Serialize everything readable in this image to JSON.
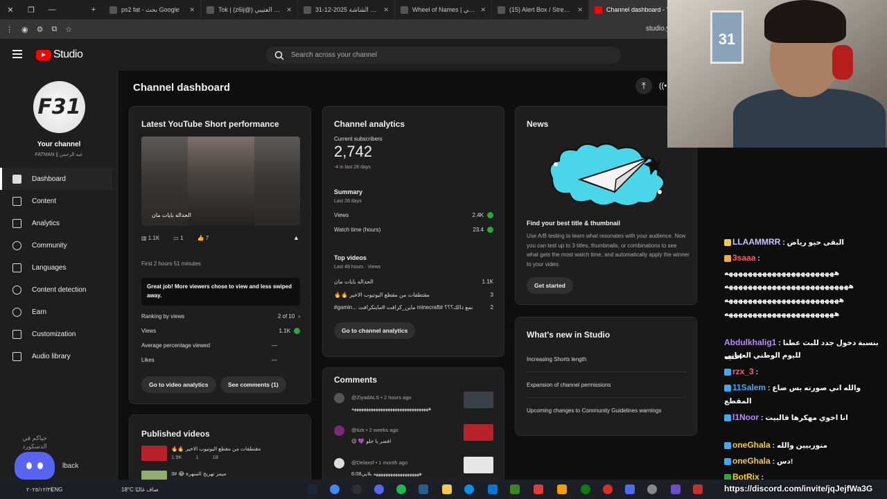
{
  "browser": {
    "tabs": [
      {
        "title": "ps2 fat - بحث Google",
        "active": false
      },
      {
        "title": "Tok | (z6ij@) تركي العتيبي",
        "active": false
      },
      {
        "title": "31-12-2025 لقطة الشاشة",
        "active": false
      },
      {
        "title": "Wheel of Names | عشوائي",
        "active": false
      },
      {
        "title": "(15) Alert Box / Streamlab",
        "active": false
      },
      {
        "title": "Channel dashboard - You",
        "active": true
      }
    ],
    "url": "studio.y"
  },
  "header": {
    "logo_text": "Studio",
    "search_placeholder": "Search across your channel"
  },
  "sidebar": {
    "avatar_text": "F31",
    "your_channel": "Your channel",
    "channel_name": "FATMAN || عبد الرحمن",
    "items": [
      {
        "label": "Dashboard",
        "icon": "dashboard-icon",
        "active": true
      },
      {
        "label": "Content",
        "icon": "content-icon"
      },
      {
        "label": "Analytics",
        "icon": "analytics-icon"
      },
      {
        "label": "Community",
        "icon": "community-icon"
      },
      {
        "label": "Languages",
        "icon": "languages-icon"
      },
      {
        "label": "Content detection",
        "icon": "copyright-icon"
      },
      {
        "label": "Earn",
        "icon": "earn-icon"
      },
      {
        "label": "Customization",
        "icon": "customization-icon"
      },
      {
        "label": "Audio library",
        "icon": "audio-library-icon"
      }
    ],
    "feedback": "lback",
    "discord_overlay": "حياكم في الدسكورد"
  },
  "main": {
    "title": "Channel dashboard",
    "short": {
      "heading": "Latest YouTube Short performance",
      "thumb_caption": "الحداله بايات مان",
      "views": "1.1K",
      "comments": "1",
      "likes": "7",
      "first_time": "First 2 hours 51 minutes",
      "callout": "Great job! More viewers chose to view and less swiped away.",
      "ranking_label": "Ranking by views",
      "ranking_value": "2 of 10",
      "views_label": "Views",
      "views_value": "1.1K",
      "avg_label": "Average percentage viewed",
      "avg_value": "—",
      "likes_label": "Likes",
      "likes_value": "—",
      "btn_analytics": "Go to video analytics",
      "btn_comments": "See comments (1)"
    },
    "analytics": {
      "heading": "Channel analytics",
      "subs_label": "Current subscribers",
      "subs_value": "2,742",
      "subs_delta": "-4",
      "subs_delta_suffix": "in last 28 days",
      "summary": "Summary",
      "summary_sub": "Last 28 days",
      "views_label": "Views",
      "views_value": "2.4K",
      "watch_label": "Watch time (hours)",
      "watch_value": "23.4",
      "top_videos": "Top videos",
      "top_sub": "Last 48 hours · Views",
      "videos": [
        {
          "title": "الحداله بايات مان",
          "views": "1.1K"
        },
        {
          "title": "🔥🔥 مقتطفات من مقطع اليوتيوب الاخير",
          "views": "3"
        },
        {
          "title": "#gamin... ماين_كرافت #ماينكرافت minecraft# ورش المجمع دالك؟؟؟",
          "views": "2"
        }
      ],
      "btn": "Go to channel analytics"
    },
    "comments": {
      "heading": "Comments",
      "items": [
        {
          "author": "@ZiyadALS",
          "time": "• 2 hours ago",
          "text": "ههههههههههههههههههههههههههههههههه"
        },
        {
          "author": "@tizk",
          "time": "• 2 weeks ago",
          "text": "😉 💜 افضر يا حلو"
        },
        {
          "author": "@Delaxsf",
          "time": "• 1 month ago",
          "text": "6:08هههههههههههههههههههه بلايي"
        }
      ]
    },
    "news": {
      "heading": "News",
      "title": "Find your best title & thumbnail",
      "desc": "Use A/B testing to learn what resonates with your audience. Now you can test up to 3 titles, thumbnails, or combinations to see what gets the most watch time, and automatically apply the winner to your video.",
      "btn": "Get started"
    },
    "whats_new": {
      "heading": "What's new in Studio",
      "items": [
        "Increasing Shorts length",
        "Expansion of channel permissions",
        "Upcoming changes to Community Guidelines warnings"
      ]
    },
    "published": {
      "heading": "Published videos",
      "items": [
        {
          "title": "🔥🔥 مقتطفات من مقطع اليوتيوب الاخير",
          "views": "1.9K",
          "comments": "1",
          "likes": "18"
        },
        {
          "title": "3# 😂 ميمز تهريج السهرة",
          "views": "",
          "comments": "",
          "likes": ""
        }
      ]
    }
  },
  "webcam": {
    "shirt_number": "31"
  },
  "chat": {
    "messages": [
      {
        "name": "LLAAMMRR",
        "color": "#c9c0ff",
        "text": " : البقى حيو رياض"
      },
      {
        "name": "3saaa",
        "color": "#ff5c5c",
        "text": " :"
      },
      {
        "name": "",
        "color": "#fff",
        "text": "هههههههههههههههههههههههه"
      },
      {
        "name": "",
        "color": "#fff",
        "text": "ههههههههههههههههههههههههههه"
      },
      {
        "name": "",
        "color": "#fff",
        "text": "ههههههههههههههههههههههههه"
      },
      {
        "name": "",
        "color": "#fff",
        "text": "هههههههههههههههههههههههه"
      },
      {
        "name": "Abdulkhalig1",
        "color": "#b98cff",
        "text": " : بنسبة دخول جدد للبث عطنا اغنيه"
      },
      {
        "name": "",
        "color": "#fff",
        "text": "لليوم الوطني العماني"
      },
      {
        "name": "rzx_3",
        "color": "#ff5c8a",
        "text": " :"
      },
      {
        "name": "11Salem",
        "color": "#3fa9f5",
        "text": " : والله اني صورته بس ضاع"
      },
      {
        "name": "",
        "color": "#fff",
        "text": "المقطع"
      },
      {
        "name": "l1Noor",
        "color": "#b98cff",
        "text": " : انا اخوي مهكرها قالبيت"
      },
      {
        "name": "oneGhala",
        "color": "#f2c94c",
        "text": " : منوربيين والله"
      },
      {
        "name": "oneGhala",
        "color": "#f2c94c",
        "text": " : دس!"
      },
      {
        "name": "BotRix",
        "color": "#ffd700",
        "text": " :"
      }
    ],
    "discord_url": "https://discord.com/invite/jqJejfWa3G"
  },
  "taskbar": {
    "weather": "18°C  صاف غالبًا",
    "lang": "ENG",
    "date": "٢٠٢٥/١٢/٣١"
  }
}
